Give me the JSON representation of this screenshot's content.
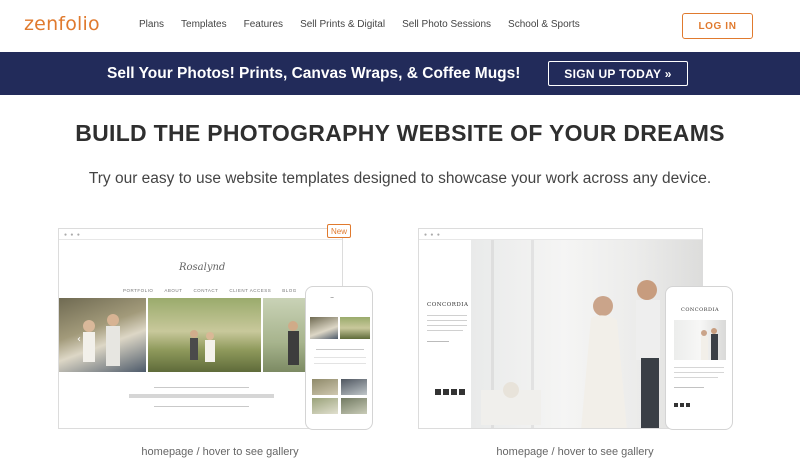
{
  "header": {
    "logo": "zenfolio",
    "nav": [
      "Plans",
      "Templates",
      "Features",
      "Sell Prints & Digital",
      "Sell Photo Sessions",
      "School & Sports"
    ],
    "login_label": "LOG IN"
  },
  "promo": {
    "text": "Sell Your Photos! Prints, Canvas Wraps, & Coffee Mugs!",
    "button_label": "SIGN UP TODAY »"
  },
  "hero": {
    "headline": "BUILD THE PHOTOGRAPHY WEBSITE OF YOUR DREAMS",
    "subline": "Try our easy to use website templates designed to showcase your work across any device."
  },
  "templates": [
    {
      "badge": "New",
      "site_title": "Rosalynd",
      "site_nav": [
        "PORTFOLIO",
        "ABOUT",
        "CONTACT",
        "CLIENT ACCESS",
        "BLOG"
      ],
      "caption": "homepage / hover to see gallery"
    },
    {
      "site_title": "CONCORDIA",
      "caption": "homepage / hover to see gallery"
    }
  ],
  "colors": {
    "brand": "#e07a2e",
    "promo_bg": "#222b5a"
  }
}
